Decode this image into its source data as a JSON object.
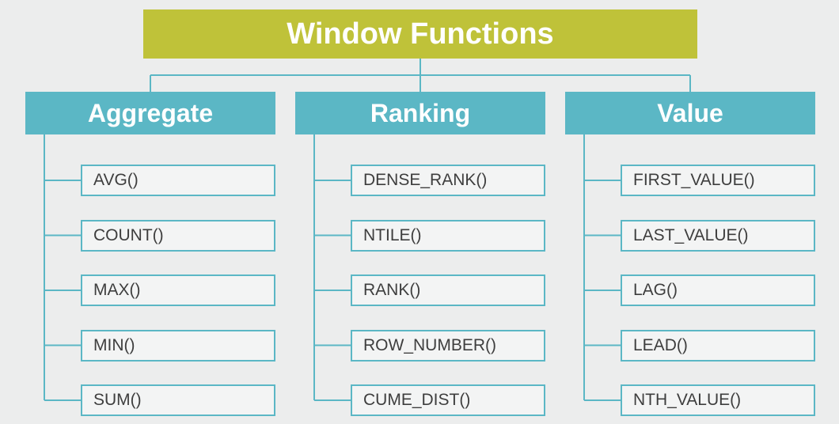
{
  "root": {
    "title": "Window Functions"
  },
  "categories": [
    {
      "title": "Aggregate",
      "items": [
        "AVG()",
        "COUNT()",
        "MAX()",
        "MIN()",
        "SUM()"
      ]
    },
    {
      "title": "Ranking",
      "items": [
        "DENSE_RANK()",
        "NTILE()",
        "RANK()",
        "ROW_NUMBER()",
        "CUME_DIST()"
      ]
    },
    {
      "title": "Value",
      "items": [
        "FIRST_VALUE()",
        "LAST_VALUE()",
        "LAG()",
        "LEAD()",
        "NTH_VALUE()"
      ]
    }
  ],
  "colors": {
    "root_bg": "#bfc239",
    "category_bg": "#5bb7c5",
    "leaf_border": "#5bb7c5",
    "page_bg": "#eceded"
  }
}
